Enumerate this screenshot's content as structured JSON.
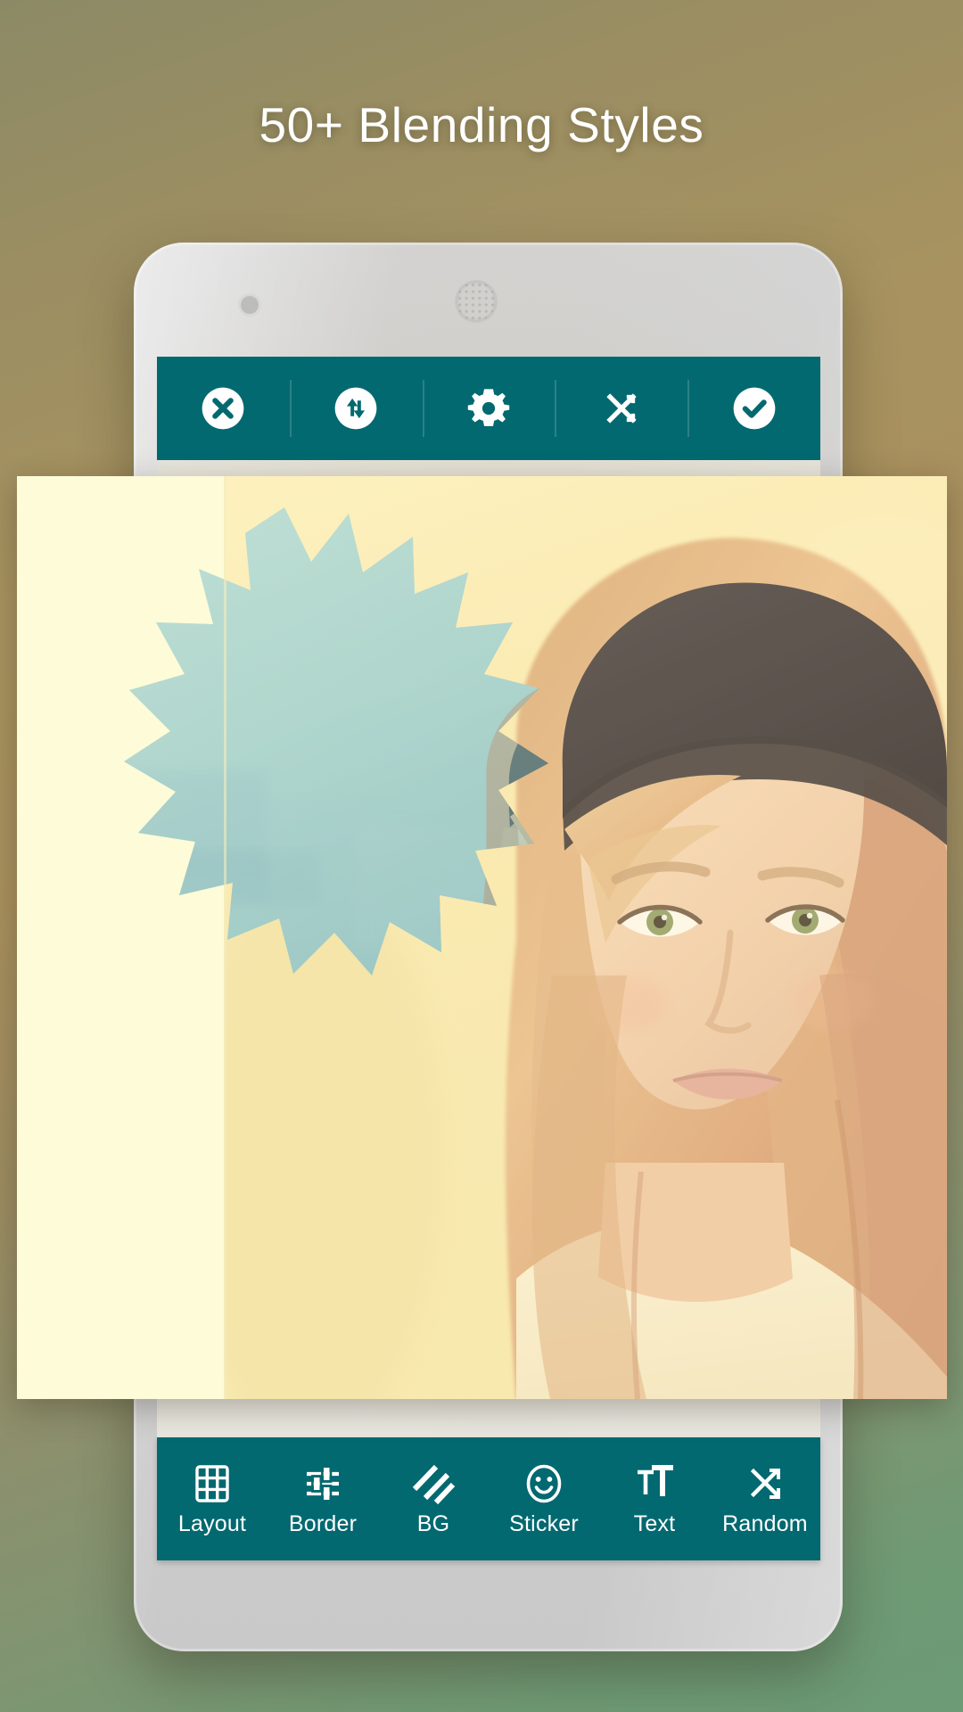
{
  "headline": "50+ Blending Styles",
  "theme": {
    "teal": "#036970",
    "white": "#ffffff",
    "bg_gradient_start": "#8c8a66",
    "bg_gradient_end": "#6c9b76",
    "phone_body": "#d0d0d0"
  },
  "phone": {
    "front_camera": "front-camera",
    "speaker": "speaker-grille"
  },
  "topbar": {
    "items": [
      {
        "icon": "close-circle-icon",
        "name": "close"
      },
      {
        "icon": "swap-vertical-circle-icon",
        "name": "swap"
      },
      {
        "icon": "gear-icon",
        "name": "settings"
      },
      {
        "icon": "shuffle-icon",
        "name": "shuffle"
      },
      {
        "icon": "check-circle-icon",
        "name": "done"
      }
    ]
  },
  "bottomnav": {
    "items": [
      {
        "label": "Layout",
        "icon": "grid-icon"
      },
      {
        "label": "Border",
        "icon": "sliders-icon"
      },
      {
        "label": "BG",
        "icon": "diagonal-stripes-icon"
      },
      {
        "label": "Sticker",
        "icon": "smiley-icon"
      },
      {
        "label": "Text",
        "icon": "text-size-icon"
      },
      {
        "label": "Random",
        "icon": "shuffle-icon"
      }
    ]
  },
  "collage": {
    "description": "Two-pane photo blend: portrait of a blonde woman in a black beanie, duplicated and blended through a sunburst/starburst mask",
    "left_pane_bg": "#fdfbd8",
    "mask_shape": "starburst",
    "blend_tint": "#a9d7c7",
    "photo_tone": "#f8edbe"
  }
}
